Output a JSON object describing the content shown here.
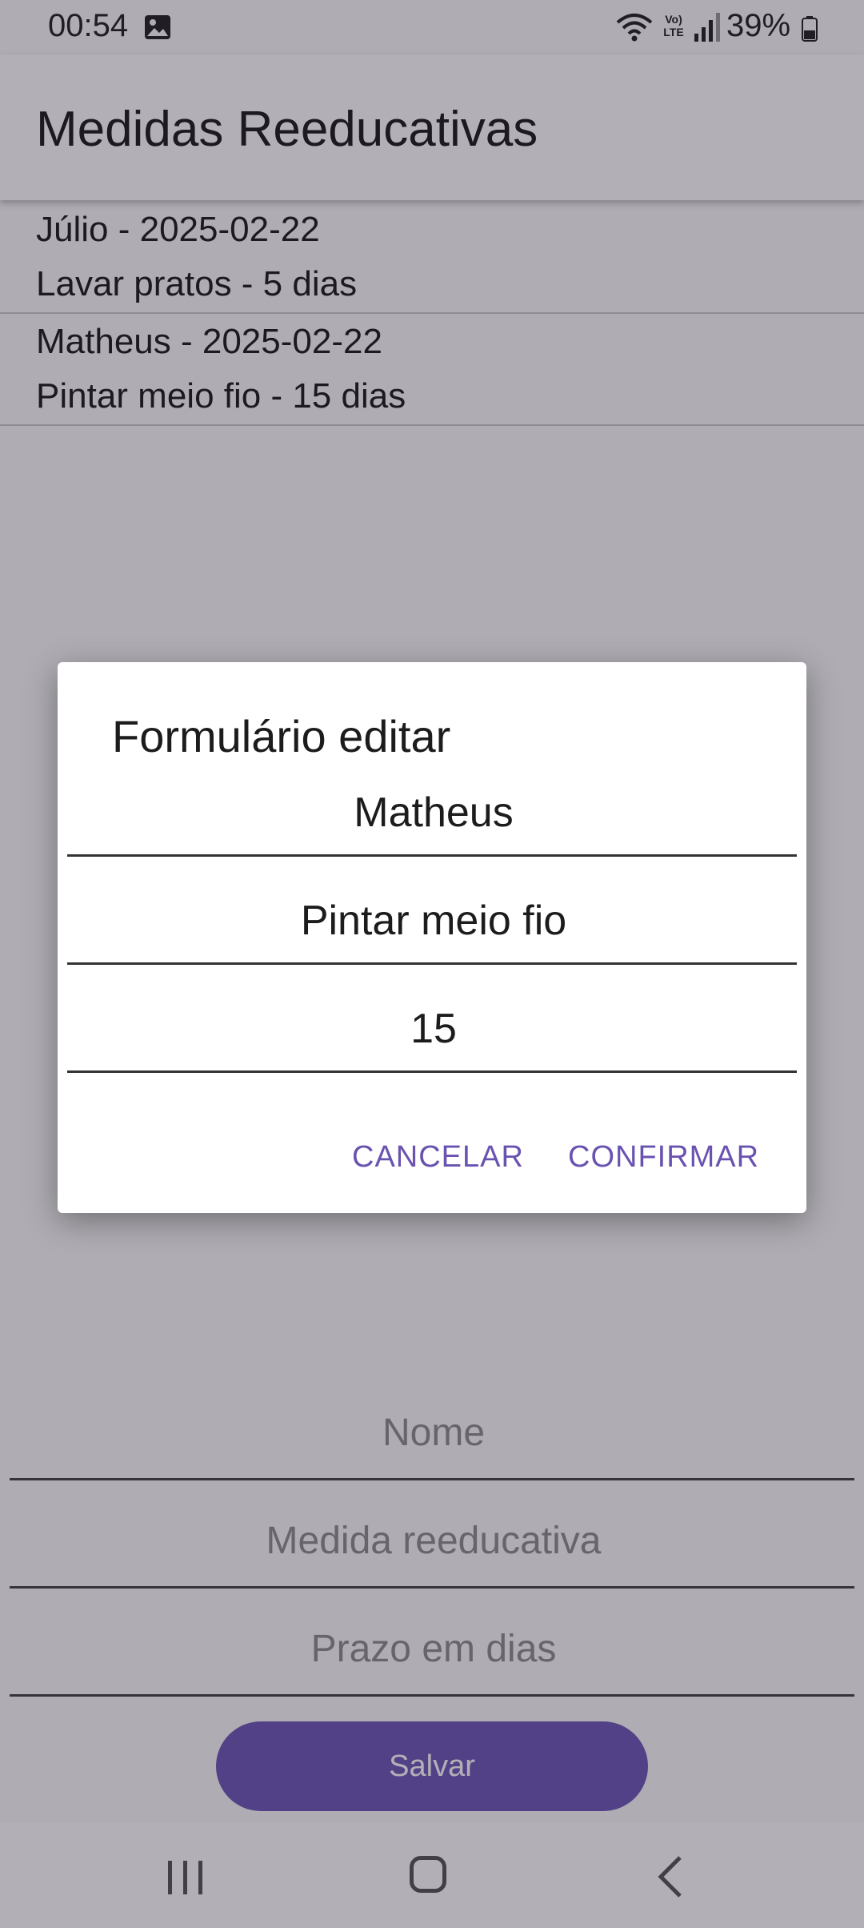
{
  "status_bar": {
    "time": "00:54",
    "volte": "Vo) LTE",
    "battery": "39%",
    "icons": [
      "gallery-icon",
      "wifi-icon",
      "volte-icon",
      "signal-icon",
      "battery-icon"
    ]
  },
  "app_bar": {
    "title": "Medidas Reeducativas"
  },
  "list": {
    "items": [
      {
        "line1": "Júlio - 2025-02-22",
        "line2": "Lavar pratos - 5 dias"
      },
      {
        "line1": "Matheus - 2025-02-22",
        "line2": "Pintar meio fio - 15 dias"
      }
    ]
  },
  "form": {
    "name_placeholder": "Nome",
    "measure_placeholder": "Medida reeducativa",
    "days_placeholder": "Prazo em dias",
    "save_label": "Salvar"
  },
  "dialog": {
    "title": "Formulário editar",
    "name_value": "Matheus",
    "measure_value": "Pintar meio fio",
    "days_value": "15",
    "cancel_label": "CANCELAR",
    "confirm_label": "CONFIRMAR"
  },
  "nav_bar": {
    "icons": [
      "recent-apps-icon",
      "home-icon",
      "back-icon"
    ]
  },
  "colors": {
    "accent": "#6a52b0",
    "button": "#6e57b8",
    "scrim": "#1e162a"
  }
}
